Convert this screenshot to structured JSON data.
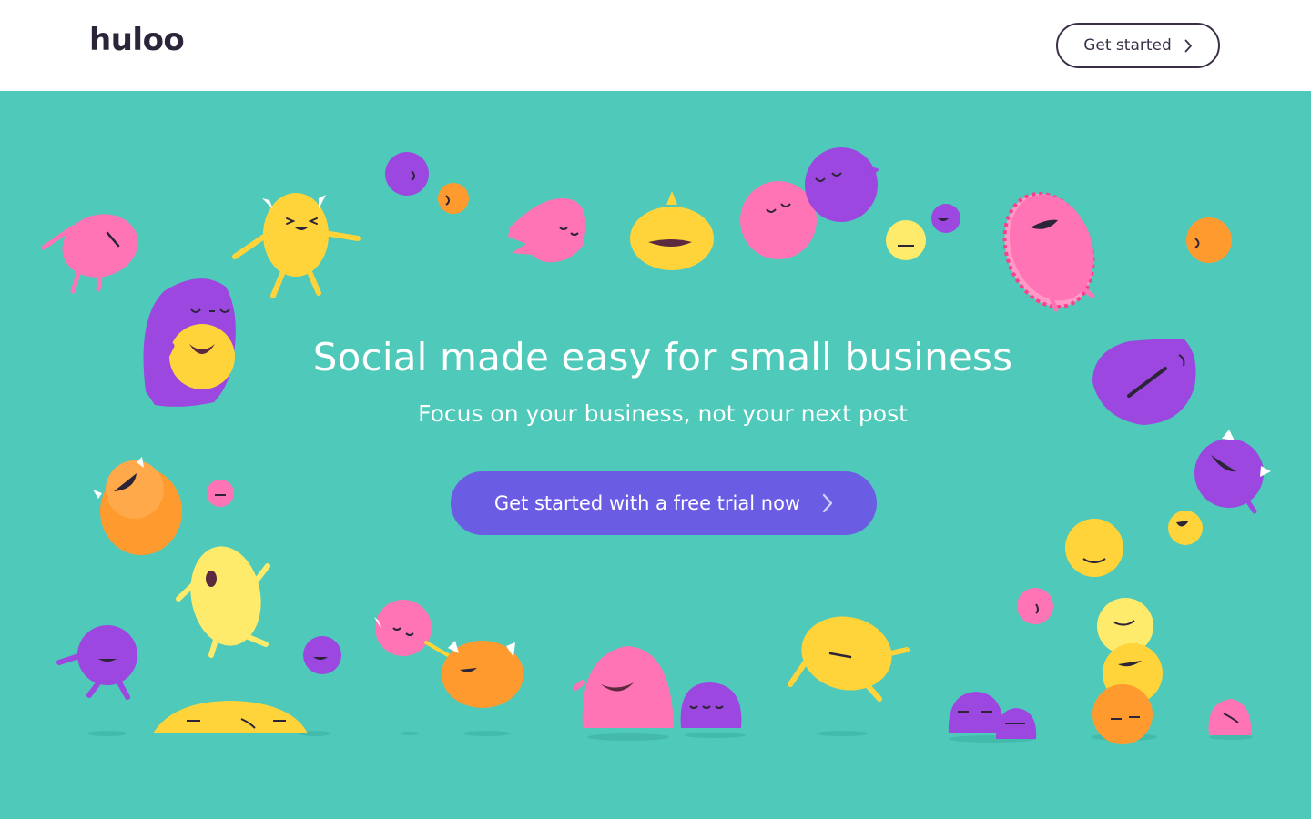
{
  "brand": {
    "logo_text": "huloo"
  },
  "header": {
    "cta_label": "Get started",
    "cta_icon": "chevron-right-icon"
  },
  "hero": {
    "title": "Social made easy for small business",
    "subtitle": "Focus on your business, not your next post",
    "cta_label": "Get started with a free trial now",
    "cta_icon": "chevron-right-icon",
    "illustration": "cartoon-monsters"
  },
  "colors": {
    "hero_background": "#4fc9b9",
    "cta_background": "#6a5de3",
    "text_dark": "#2c2438",
    "pink": "#ff74b4",
    "purple": "#9b47e0",
    "yellow": "#ffd43b",
    "orange": "#ff9a2e"
  }
}
